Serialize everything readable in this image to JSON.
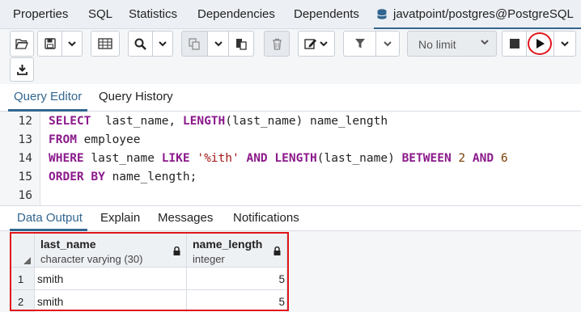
{
  "top_tabs": {
    "properties": "Properties",
    "sql": "SQL",
    "statistics": "Statistics",
    "dependencies": "Dependencies",
    "dependents": "Dependents",
    "connection": "javatpoint/postgres@PostgreSQL"
  },
  "toolbar": {
    "limit_value": "No limit",
    "icons": [
      "open-file-icon",
      "save-icon",
      "chevron-down-icon",
      "table-icon",
      "search-icon",
      "copy-icon",
      "paste-icon",
      "delete-icon",
      "edit-icon",
      "filter-icon",
      "stop-icon",
      "execute-icon",
      "download-icon"
    ]
  },
  "editor_tabs": {
    "query_editor": "Query Editor",
    "query_history": "Query History"
  },
  "editor": {
    "lines": [
      {
        "no": "12",
        "parts": [
          [
            "kw",
            "SELECT"
          ],
          [
            "",
            "  last_name, "
          ],
          [
            "kw",
            "LENGTH"
          ],
          [
            "",
            "(last_name) name_length"
          ]
        ]
      },
      {
        "no": "13",
        "parts": [
          [
            "kw",
            "FROM"
          ],
          [
            "",
            " employee"
          ]
        ]
      },
      {
        "no": "14",
        "parts": [
          [
            "kw",
            "WHERE"
          ],
          [
            "",
            " last_name "
          ],
          [
            "kw",
            "LIKE"
          ],
          [
            "",
            " "
          ],
          [
            "str",
            "'%ith'"
          ],
          [
            "",
            " "
          ],
          [
            "kw",
            "AND"
          ],
          [
            "",
            " "
          ],
          [
            "kw",
            "LENGTH"
          ],
          [
            "",
            "(last_name) "
          ],
          [
            "kw",
            "BETWEEN"
          ],
          [
            "",
            " "
          ],
          [
            "num",
            "2"
          ],
          [
            "",
            " "
          ],
          [
            "kw",
            "AND"
          ],
          [
            "",
            " "
          ],
          [
            "num",
            "6"
          ]
        ]
      },
      {
        "no": "15",
        "parts": [
          [
            "kw",
            "ORDER BY"
          ],
          [
            "",
            " name_length;"
          ]
        ]
      },
      {
        "no": "16",
        "parts": []
      }
    ]
  },
  "output_tabs": {
    "data_output": "Data Output",
    "explain": "Explain",
    "messages": "Messages",
    "notifications": "Notifications"
  },
  "grid": {
    "columns": [
      {
        "name": "last_name",
        "type": "character varying (30)"
      },
      {
        "name": "name_length",
        "type": "integer"
      }
    ],
    "rows": [
      {
        "no": "1",
        "last_name": "smith",
        "name_length": "5"
      },
      {
        "no": "2",
        "last_name": "smith",
        "name_length": "5"
      }
    ]
  },
  "colors": {
    "accent": "#326690",
    "highlight": "#e0151c",
    "keyword": "#8b1a8b",
    "string": "#a31515"
  }
}
